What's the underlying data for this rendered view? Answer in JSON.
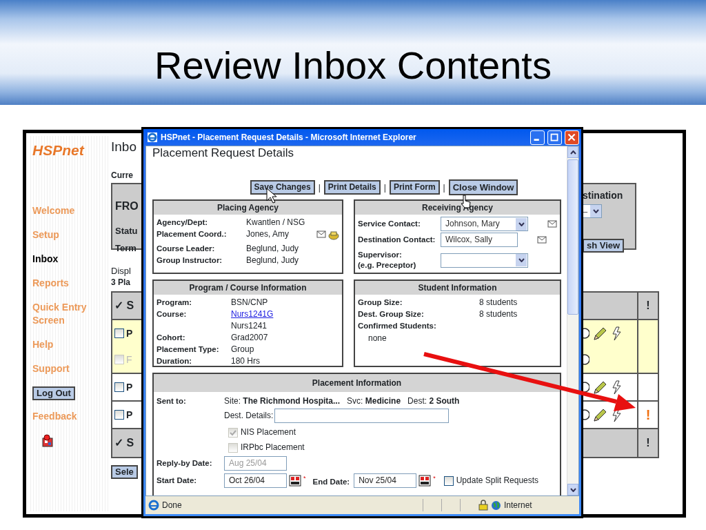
{
  "slide": {
    "title": "Review Inbox Contents"
  },
  "inbox_page": {
    "logo": "HSPnet",
    "nav": [
      {
        "label": "Welcome",
        "kind": "link",
        "selected": false
      },
      {
        "label": "Setup",
        "kind": "link",
        "selected": false
      },
      {
        "label": "Inbox",
        "kind": "link",
        "selected": true
      },
      {
        "label": "Reports",
        "kind": "link",
        "selected": false
      },
      {
        "label": "Quick Entry Screen",
        "kind": "link",
        "selected": false
      },
      {
        "label": "Help",
        "kind": "link",
        "selected": false
      },
      {
        "label": "Support",
        "kind": "link",
        "selected": false
      },
      {
        "label": "Log Out",
        "kind": "button",
        "selected": false
      },
      {
        "label": "Feedback",
        "kind": "link",
        "selected": false
      }
    ],
    "page_title": "Inbo",
    "current_label": "Curre",
    "filter_left": [
      "FRO",
      "Statu",
      "Term"
    ],
    "filter_right": {
      "label": "stination",
      "select_value": "–",
      "button": "sh View"
    },
    "display_text": "Displ",
    "count_text": "3 Pla",
    "table": {
      "header": "✓ S",
      "flag_header": "!",
      "footer": "✓ S",
      "flag_footer": "!",
      "rows": [
        {
          "highlighted": true,
          "lines": [
            {
              "text": "P",
              "disabled": false
            },
            {
              "text": "F",
              "disabled": true
            }
          ]
        },
        {
          "highlighted": false,
          "lines": [
            {
              "text": "P",
              "disabled": false
            }
          ]
        },
        {
          "highlighted": false,
          "lines": [
            {
              "text": "P",
              "disabled": false
            }
          ],
          "flag": "!"
        }
      ]
    },
    "select_button": "Sele"
  },
  "popup": {
    "title": "HSPnet - Placement Request Details - Microsoft Internet Explorer",
    "heading": "Placement Request Details",
    "buttons": [
      "Save Changes",
      "Print Details",
      "Print Form",
      "Close Window"
    ],
    "separator": "|",
    "placing_agency": {
      "title": "Placing Agency",
      "rows": [
        {
          "label": "Agency/Dept:",
          "value": "Kwantlen / NSG",
          "contact_icons": false
        },
        {
          "label": "Placement Coord.:",
          "value": "Jones, Amy",
          "contact_icons": true
        },
        {
          "label": "Course Leader:",
          "value": "Beglund, Judy",
          "contact_icons": false
        },
        {
          "label": "Group Instructor:",
          "value": "Beglund, Judy",
          "contact_icons": false
        }
      ]
    },
    "receiving_agency": {
      "title": "Receiving Agency",
      "rows": [
        {
          "label": "Service Contact:",
          "kind": "select",
          "value": "Johnson, Mary",
          "mail": true
        },
        {
          "label": "Destination Contact:",
          "kind": "text",
          "value": "Wilcox, Sally",
          "mail": true
        },
        {
          "label": "Supervisor:",
          "sublabel": "(e.g. Preceptor)",
          "kind": "select",
          "mail": false
        }
      ]
    },
    "program_course": {
      "title": "Program / Course Information",
      "rows": [
        {
          "label": "Program:",
          "value": "BSN/CNP",
          "link": false
        },
        {
          "label": "Course:",
          "value": "Nurs1241G",
          "link": true
        },
        {
          "value": "Nurs1241",
          "link": false
        },
        {
          "label": "Cohort:",
          "value": "Grad2007",
          "link": false
        },
        {
          "label": "Placement Type:",
          "value": "Group",
          "link": false
        },
        {
          "label": "Duration:",
          "value": "180 Hrs",
          "link": false
        }
      ]
    },
    "student_info": {
      "title": "Student Information",
      "rows": [
        {
          "label": "Group Size:",
          "value": "8 students"
        },
        {
          "label": "Dest. Group Size:",
          "value": "8 students"
        },
        {
          "label": "Confirmed Students:"
        }
      ],
      "confirmed": "none"
    },
    "placement_info": {
      "title": "Placement Information",
      "sent_to_label": "Sent to:",
      "sent_to": "Site: **The Richmond Hospita...**   Svc: **Medicine**   Dest: **2 South**",
      "dest_details_label": "Dest. Details:",
      "checkboxes": [
        {
          "label": "NIS Placement",
          "checked": true,
          "disabled": true
        },
        {
          "label": "IRPbc Placement",
          "checked": false,
          "disabled": true
        }
      ],
      "reply_by": {
        "label": "Reply-by Date:",
        "value": "Aug 25/04",
        "disabled": true
      },
      "start": {
        "label": "Start Date:",
        "value": "Oct 26/04",
        "required": "*"
      },
      "end": {
        "label": "End Date:",
        "value": "Nov 25/04",
        "required": "*"
      },
      "update_split": {
        "label": "Update Split Requests",
        "checked": false
      }
    },
    "status_bar": {
      "text": "Done",
      "zone": "Internet"
    }
  }
}
